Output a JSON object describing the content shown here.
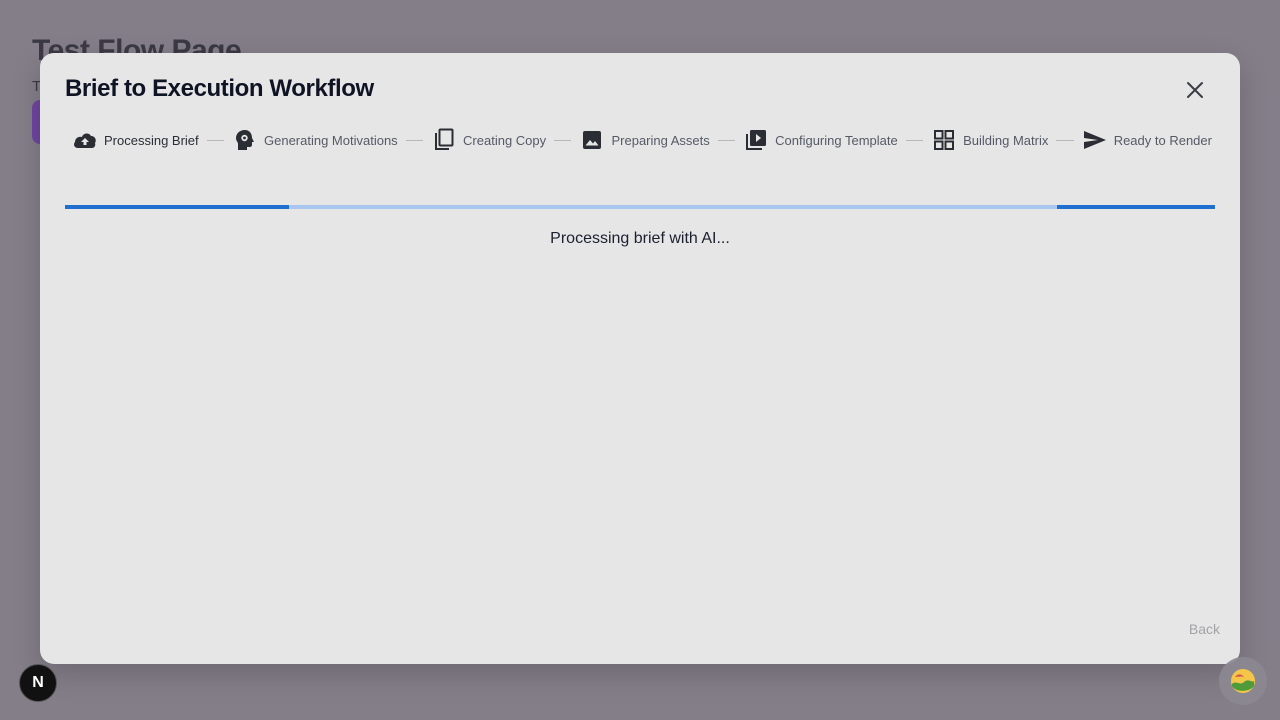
{
  "background_page": {
    "title": "Test Flow Page",
    "subtitle": "T"
  },
  "modal": {
    "title": "Brief to Execution Workflow",
    "steps": [
      {
        "label": "Processing Brief",
        "icon": "cloud-upload-icon"
      },
      {
        "label": "Generating Motivations",
        "icon": "brain-gear-icon"
      },
      {
        "label": "Creating Copy",
        "icon": "copy-icon"
      },
      {
        "label": "Preparing Assets",
        "icon": "image-icon"
      },
      {
        "label": "Configuring Template",
        "icon": "video-library-icon"
      },
      {
        "label": "Building Matrix",
        "icon": "grid-icon"
      },
      {
        "label": "Ready to Render",
        "icon": "send-icon"
      }
    ],
    "active_step": 0,
    "status": "Processing brief with AI...",
    "back_label": "Back"
  },
  "corner": {
    "badge_letter": "N"
  },
  "colors": {
    "progress_fill": "#1e6fd0",
    "progress_track": "#a8c6ee",
    "modal_bg": "#e6e6e6"
  }
}
